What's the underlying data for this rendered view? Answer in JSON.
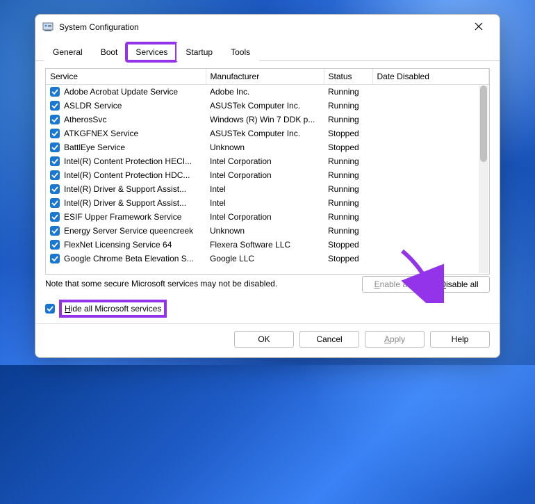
{
  "window": {
    "title": "System Configuration"
  },
  "tabs": {
    "general": "General",
    "boot": "Boot",
    "services": "Services",
    "startup": "Startup",
    "tools": "Tools"
  },
  "columns": {
    "service": "Service",
    "manufacturer": "Manufacturer",
    "status": "Status",
    "date_disabled": "Date Disabled"
  },
  "services": [
    {
      "checked": true,
      "name": "Adobe Acrobat Update Service",
      "mfr": "Adobe Inc.",
      "status": "Running"
    },
    {
      "checked": true,
      "name": "ASLDR Service",
      "mfr": "ASUSTek Computer Inc.",
      "status": "Running"
    },
    {
      "checked": true,
      "name": "AtherosSvc",
      "mfr": "Windows (R) Win 7 DDK p...",
      "status": "Running"
    },
    {
      "checked": true,
      "name": "ATKGFNEX Service",
      "mfr": "ASUSTek Computer Inc.",
      "status": "Stopped"
    },
    {
      "checked": true,
      "name": "BattlEye Service",
      "mfr": "Unknown",
      "status": "Stopped"
    },
    {
      "checked": true,
      "name": "Intel(R) Content Protection HECI...",
      "mfr": "Intel Corporation",
      "status": "Running"
    },
    {
      "checked": true,
      "name": "Intel(R) Content Protection HDC...",
      "mfr": "Intel Corporation",
      "status": "Running"
    },
    {
      "checked": true,
      "name": "Intel(R) Driver & Support Assist...",
      "mfr": "Intel",
      "status": "Running"
    },
    {
      "checked": true,
      "name": "Intel(R) Driver & Support Assist...",
      "mfr": "Intel",
      "status": "Running"
    },
    {
      "checked": true,
      "name": "ESIF Upper Framework Service",
      "mfr": "Intel Corporation",
      "status": "Running"
    },
    {
      "checked": true,
      "name": "Energy Server Service queencreek",
      "mfr": "Unknown",
      "status": "Running"
    },
    {
      "checked": true,
      "name": "FlexNet Licensing Service 64",
      "mfr": "Flexera Software LLC",
      "status": "Stopped"
    },
    {
      "checked": true,
      "name": "Google Chrome Beta Elevation S...",
      "mfr": "Google LLC",
      "status": "Stopped"
    }
  ],
  "note": "Note that some secure Microsoft services may not be disabled.",
  "buttons": {
    "enable_all": "Enable all",
    "disable_all": "Disable all",
    "ok": "OK",
    "cancel": "Cancel",
    "apply": "Apply",
    "help": "Help"
  },
  "hide_ms": {
    "checked": true,
    "label": "Hide all Microsoft services"
  },
  "colors": {
    "highlight": "#9333ea",
    "check_bg": "#1976d2"
  }
}
